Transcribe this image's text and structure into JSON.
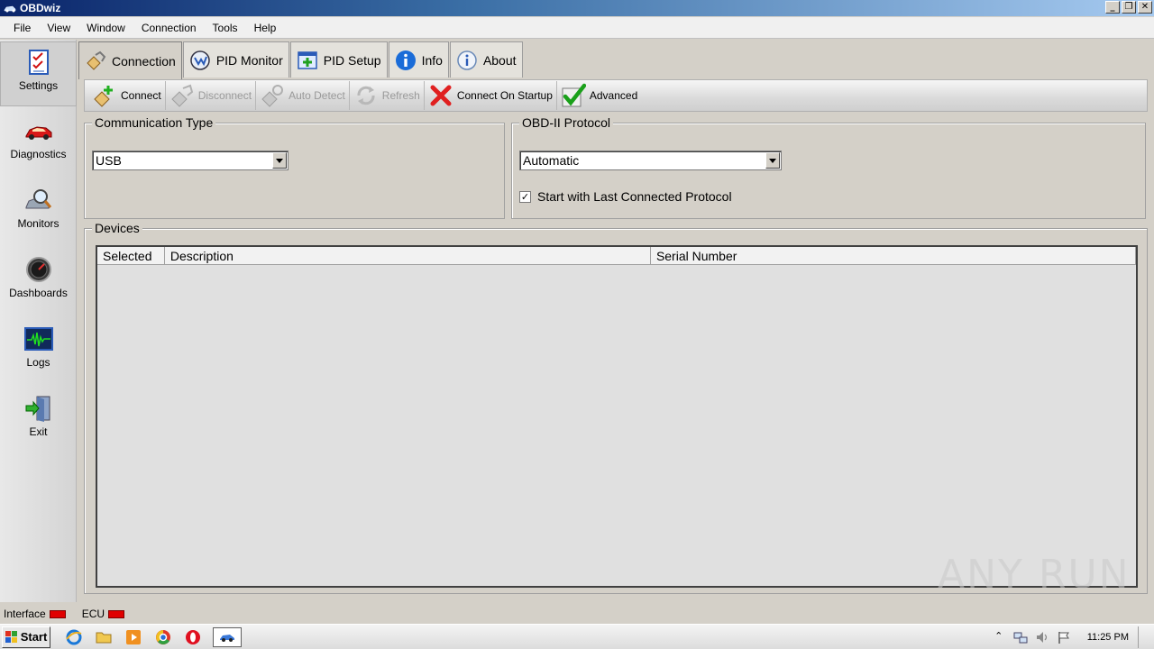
{
  "window": {
    "title": "OBDwiz",
    "controls": {
      "minimize": "_",
      "restore": "❐",
      "close": "✕"
    }
  },
  "menu": {
    "items": [
      "File",
      "View",
      "Window",
      "Connection",
      "Tools",
      "Help"
    ]
  },
  "sidebar": {
    "items": [
      {
        "label": "Settings",
        "icon": "settings-checklist-icon",
        "active": true
      },
      {
        "label": "Diagnostics",
        "icon": "car-icon",
        "active": false
      },
      {
        "label": "Monitors",
        "icon": "magnifier-icon",
        "active": false
      },
      {
        "label": "Dashboards",
        "icon": "gauge-icon",
        "active": false
      },
      {
        "label": "Logs",
        "icon": "waveform-icon",
        "active": false
      },
      {
        "label": "Exit",
        "icon": "exit-door-icon",
        "active": false
      }
    ]
  },
  "tabs": [
    {
      "label": "Connection",
      "icon": "connection-plug-icon",
      "active": true
    },
    {
      "label": "PID Monitor",
      "icon": "pid-monitor-icon",
      "active": false
    },
    {
      "label": "PID Setup",
      "icon": "pid-setup-icon",
      "active": false
    },
    {
      "label": "Info",
      "icon": "info-icon",
      "active": false
    },
    {
      "label": "About",
      "icon": "about-icon",
      "active": false
    }
  ],
  "toolbar": {
    "connect": "Connect",
    "disconnect": "Disconnect",
    "auto_detect": "Auto Detect",
    "refresh": "Refresh",
    "connect_on_startup": "Connect On Startup",
    "advanced": "Advanced"
  },
  "communication": {
    "title": "Communication Type",
    "selected": "USB"
  },
  "protocol": {
    "title": "OBD-II Protocol",
    "selected": "Automatic",
    "checkbox_label": "Start with Last Connected Protocol",
    "checkbox_checked": true
  },
  "devices": {
    "title": "Devices",
    "columns": [
      "Selected",
      "Description",
      "Serial Number"
    ]
  },
  "status": {
    "interface_label": "Interface",
    "ecu_label": "ECU",
    "led_color": "#e00000"
  },
  "taskbar": {
    "start_label": "Start",
    "clock": "11:25 PM"
  },
  "watermark": "ANY RUN"
}
